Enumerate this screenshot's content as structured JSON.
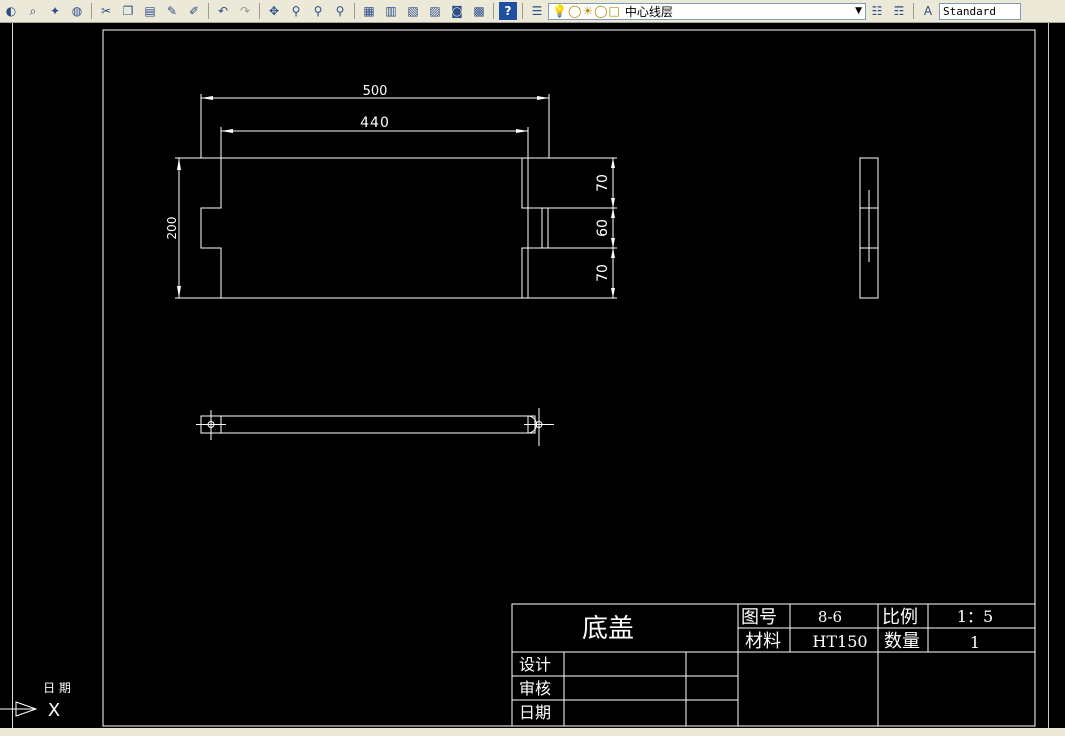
{
  "toolbar": {
    "layer_name": "中心线层",
    "layer_icons": "💡◯☀◯□",
    "text_style": "Standard"
  },
  "drawing": {
    "dim_500": "500",
    "dim_440": "440",
    "dim_200": "200",
    "dim_70_top": "70",
    "dim_60": "60",
    "dim_70_bottom": "70"
  },
  "title_block": {
    "part_name": "底盖",
    "drawing_no_label": "图号",
    "drawing_no": "8-6",
    "scale_label": "比例",
    "scale": "1：5",
    "material_label": "材料",
    "material": "HT150",
    "quantity_label": "数量",
    "quantity": "1",
    "design_label": "设计",
    "review_label": "审核",
    "date_label": "日期"
  },
  "ucs": {
    "x_label": "X",
    "date_text": "日 期"
  }
}
